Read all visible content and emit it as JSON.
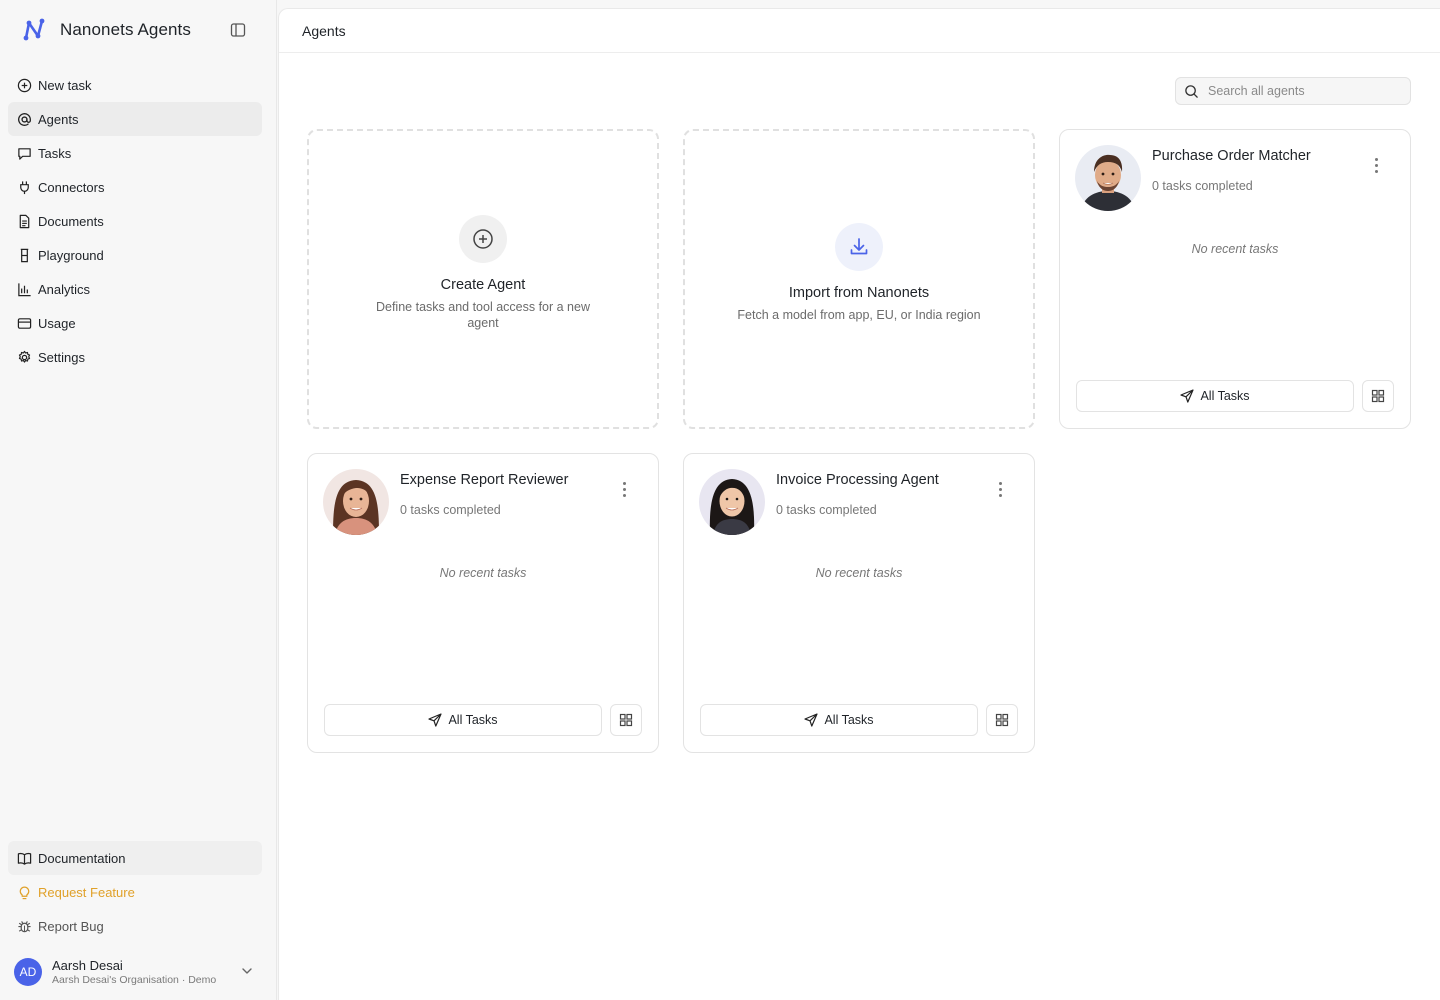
{
  "brand": {
    "title": "Nanonets Agents"
  },
  "nav": {
    "items": [
      {
        "label": "New task",
        "icon": "plus-circle-icon"
      },
      {
        "label": "Agents",
        "icon": "at-sign-icon"
      },
      {
        "label": "Tasks",
        "icon": "message-square-icon"
      },
      {
        "label": "Connectors",
        "icon": "plug-icon"
      },
      {
        "label": "Documents",
        "icon": "file-text-icon"
      },
      {
        "label": "Playground",
        "icon": "beaker-icon"
      },
      {
        "label": "Analytics",
        "icon": "bar-chart-icon"
      },
      {
        "label": "Usage",
        "icon": "credit-card-icon"
      },
      {
        "label": "Settings",
        "icon": "gear-icon"
      }
    ],
    "active": "Agents"
  },
  "bottom_nav": {
    "documentation": "Documentation",
    "request_feature": "Request Feature",
    "report_bug": "Report Bug"
  },
  "user": {
    "initials": "AD",
    "name": "Aarsh Desai",
    "org": "Aarsh Desai's Organisation · Demo"
  },
  "header": {
    "title": "Agents"
  },
  "search": {
    "placeholder": "Search all agents"
  },
  "actions": {
    "create": {
      "title": "Create Agent",
      "desc": "Define tasks and tool access for a new agent"
    },
    "import": {
      "title": "Import from Nanonets",
      "desc": "Fetch a model from app, EU, or India region"
    }
  },
  "agents": [
    {
      "name": "Purchase Order Matcher",
      "count": "0 tasks completed",
      "recent": "No recent tasks",
      "button": "All Tasks"
    },
    {
      "name": "Expense Report Reviewer",
      "count": "0 tasks completed",
      "recent": "No recent tasks",
      "button": "All Tasks"
    },
    {
      "name": "Invoice Processing Agent",
      "count": "0 tasks completed",
      "recent": "No recent tasks",
      "button": "All Tasks"
    }
  ],
  "colors": {
    "accent": "#4a63e8",
    "feature": "#e0a12a",
    "active_bg": "#ececec"
  }
}
